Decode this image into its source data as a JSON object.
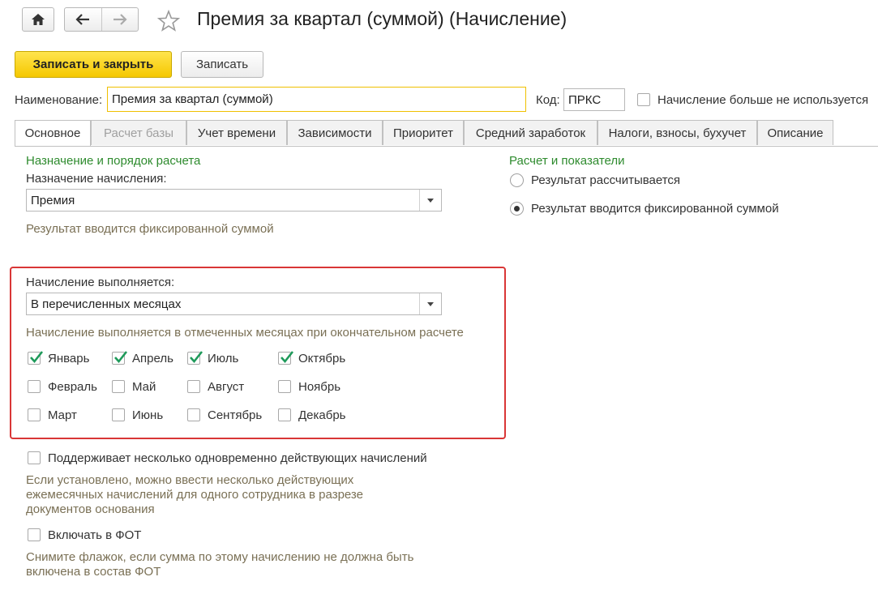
{
  "header": {
    "title": "Премия за квартал (суммой) (Начисление)"
  },
  "toolbar": {
    "save_close_label": "Записать и закрыть",
    "save_label": "Записать"
  },
  "form": {
    "name_label": "Наименование:",
    "name_value": "Премия за квартал (суммой)",
    "code_label": "Код:",
    "code_value": "ПРКС",
    "not_used_label": "Начисление больше не используется",
    "not_used_checked": false
  },
  "tabs": [
    {
      "label": "Основное",
      "active": true,
      "disabled": false
    },
    {
      "label": "Расчет базы",
      "active": false,
      "disabled": true
    },
    {
      "label": "Учет времени",
      "active": false,
      "disabled": false
    },
    {
      "label": "Зависимости",
      "active": false,
      "disabled": false
    },
    {
      "label": "Приоритет",
      "active": false,
      "disabled": false
    },
    {
      "label": "Средний заработок",
      "active": false,
      "disabled": false
    },
    {
      "label": "Налоги, взносы, бухучет",
      "active": false,
      "disabled": false
    },
    {
      "label": "Описание",
      "active": false,
      "disabled": false
    }
  ],
  "purpose": {
    "section_title": "Назначение и порядок расчета",
    "label": "Назначение начисления:",
    "value": "Премия",
    "hint": "Результат вводится фиксированной суммой"
  },
  "execution": {
    "label": "Начисление выполняется:",
    "value": "В перечисленных месяцах",
    "hint": "Начисление выполняется в отмеченных месяцах при окончательном расчете",
    "months": [
      {
        "label": "Январь",
        "checked": true
      },
      {
        "label": "Апрель",
        "checked": true
      },
      {
        "label": "Июль",
        "checked": true
      },
      {
        "label": "Октябрь",
        "checked": true
      },
      {
        "label": "Февраль",
        "checked": false
      },
      {
        "label": "Май",
        "checked": false
      },
      {
        "label": "Август",
        "checked": false
      },
      {
        "label": "Ноябрь",
        "checked": false
      },
      {
        "label": "Март",
        "checked": false
      },
      {
        "label": "Июнь",
        "checked": false
      },
      {
        "label": "Сентябрь",
        "checked": false
      },
      {
        "label": "Декабрь",
        "checked": false
      }
    ]
  },
  "multiple": {
    "label": "Поддерживает несколько одновременно действующих начислений",
    "checked": false,
    "hint_lines": [
      "Если установлено, можно ввести несколько действующих",
      "ежемесячных начислений для одного сотрудника в разрезе",
      "документов основания"
    ]
  },
  "fot": {
    "label": "Включать в ФОТ",
    "checked": false,
    "hint_lines": [
      "Снимите флажок, если сумма по этому начислению не должна быть",
      "включена в состав ФОТ"
    ]
  },
  "calc": {
    "section_title": "Расчет и показатели",
    "options": [
      {
        "label": "Результат рассчитывается",
        "selected": false
      },
      {
        "label": "Результат вводится фиксированной суммой",
        "selected": true
      }
    ]
  },
  "colors": {
    "accent_green": "#2e8b2e",
    "primary_button": "#f5c800",
    "highlight_border": "#d93636",
    "checkmark": "#1e9a5a"
  }
}
